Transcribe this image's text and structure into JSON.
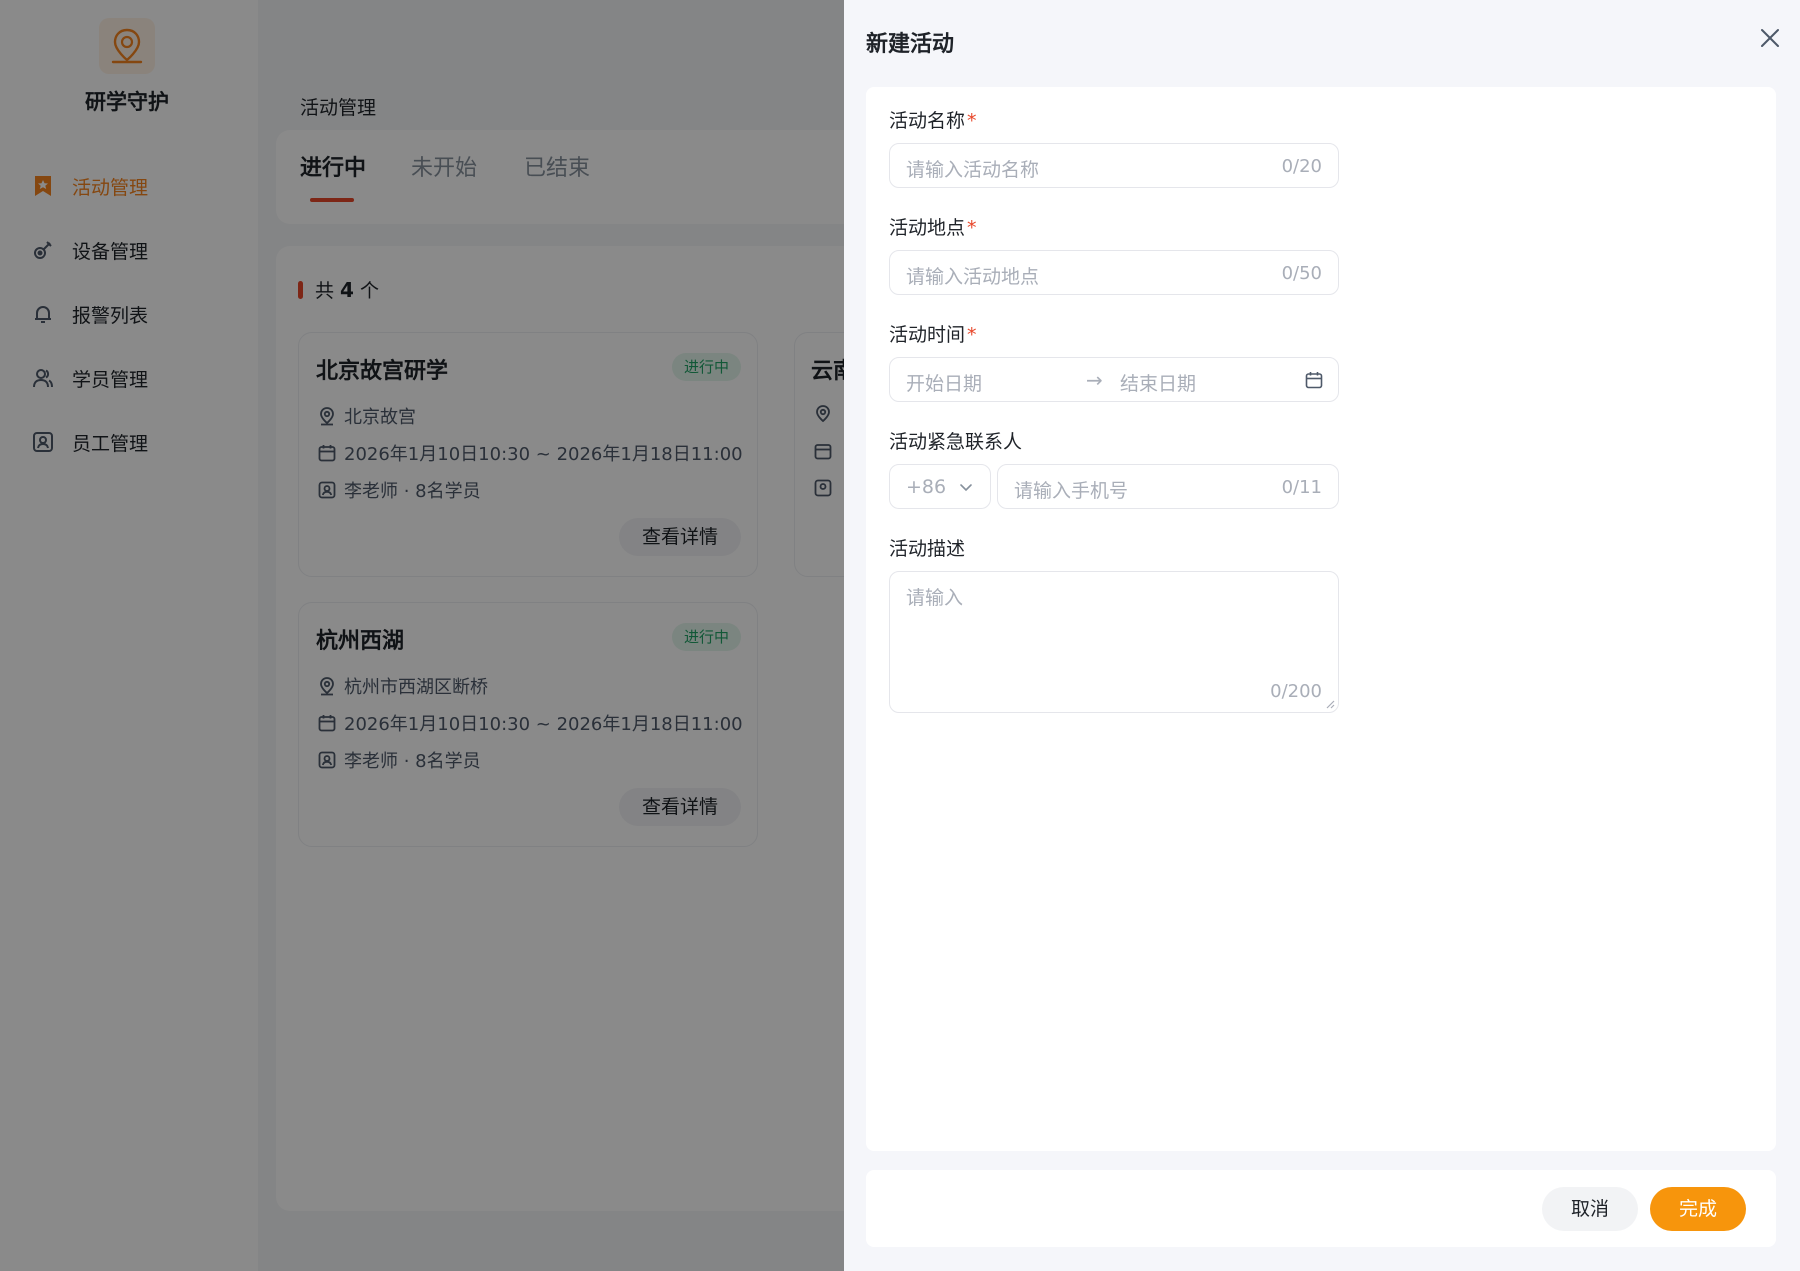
{
  "app": {
    "name": "研学守护",
    "logo_icon": "compass-location-logo"
  },
  "sidebar": {
    "items": [
      {
        "label": "活动管理",
        "icon": "bookmark-star-icon",
        "active": true
      },
      {
        "label": "设备管理",
        "icon": "link-device-icon",
        "active": false
      },
      {
        "label": "报警列表",
        "icon": "bell-icon",
        "active": false
      },
      {
        "label": "学员管理",
        "icon": "users-icon",
        "active": false
      },
      {
        "label": "员工管理",
        "icon": "id-badge-icon",
        "active": false
      }
    ]
  },
  "main": {
    "breadcrumb": "活动管理",
    "tabs": [
      {
        "label": "进行中",
        "active": true
      },
      {
        "label": "未开始",
        "active": false
      },
      {
        "label": "已结束",
        "active": false
      }
    ],
    "count": {
      "prefix": "共",
      "value": "4",
      "suffix": "个"
    },
    "cards": [
      {
        "title": "北京故宫研学",
        "status": "进行中",
        "location": "北京故宫",
        "time": "2026年1月10日10:30 ~ 2026年1月18日11:00",
        "people": "李老师 · 8名学员",
        "action": "查看详情"
      },
      {
        "title": "杭州西湖",
        "status": "进行中",
        "location": "杭州市西湖区断桥",
        "time": "2026年1月10日10:30 ~ 2026年1月18日11:00",
        "people": "李老师 · 8名学员",
        "action": "查看详情"
      }
    ],
    "partial_card": {
      "title": "云南"
    }
  },
  "drawer": {
    "title": "新建活动",
    "fields": {
      "name": {
        "label": "活动名称",
        "placeholder": "请输入活动名称",
        "counter": "0/20",
        "required": true
      },
      "location": {
        "label": "活动地点",
        "placeholder": "请输入活动地点",
        "counter": "0/50",
        "required": true
      },
      "time": {
        "label": "活动时间",
        "start_placeholder": "开始日期",
        "arrow": "→",
        "end_placeholder": "结束日期",
        "required": true
      },
      "contact": {
        "label": "活动紧急联系人",
        "country_code": "+86",
        "placeholder": "请输入手机号",
        "counter": "0/11"
      },
      "description": {
        "label": "活动描述",
        "placeholder": "请输入",
        "counter": "0/200"
      }
    },
    "required_mark": "*",
    "buttons": {
      "cancel": "取消",
      "confirm": "完成"
    }
  },
  "colors": {
    "accent": "#f5841f",
    "primary_button": "#f7950c",
    "required": "#e8472a",
    "status_green": "#21a366"
  }
}
